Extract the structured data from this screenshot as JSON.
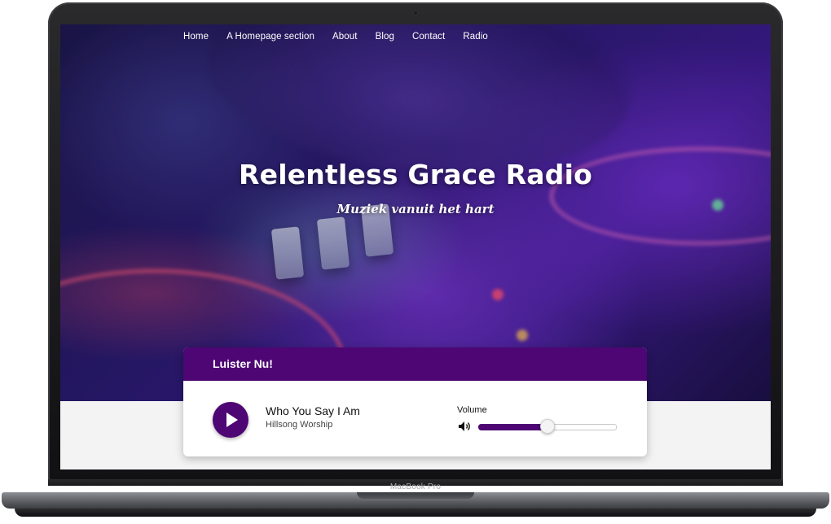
{
  "nav": {
    "items": [
      {
        "label": "Home"
      },
      {
        "label": "A Homepage section"
      },
      {
        "label": "About"
      },
      {
        "label": "Blog"
      },
      {
        "label": "Contact"
      },
      {
        "label": "Radio"
      }
    ]
  },
  "hero": {
    "title": "Relentless Grace Radio",
    "tagline": "Muziek vanuit het hart"
  },
  "player": {
    "header": "Luister Nu!",
    "play_icon": "play-icon",
    "track_title": "Who You Say I Am",
    "track_artist": "Hillsong Worship",
    "volume_label": "Volume",
    "volume_icon": "speaker-icon",
    "volume_level": 0.5
  },
  "device": {
    "label": "MacBook Pro"
  },
  "colors": {
    "accent": "#4d0673",
    "card_background": "#ffffff",
    "page_background": "#f3f3f4"
  }
}
